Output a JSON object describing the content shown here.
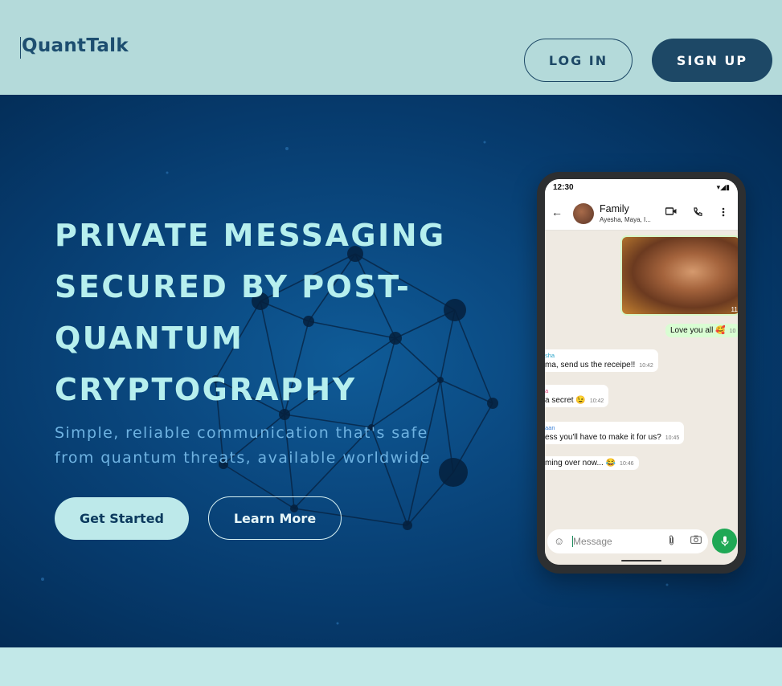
{
  "header": {
    "logo": "QuantTalk",
    "login_label": "LOG IN",
    "signup_label": "SIGN UP"
  },
  "hero": {
    "headline_lines": [
      "PRIVATE MESSAGING",
      "SECURED BY POST-",
      "QUANTUM",
      "CRYPTOGRAPHY"
    ],
    "subhead_lines": [
      "Simple, reliable communication that's safe",
      "from quantum threats, available worldwide"
    ],
    "get_started_label": "Get Started",
    "learn_more_label": "Learn More"
  },
  "phone": {
    "time": "12:30",
    "chat_title": "Family",
    "chat_members": "Ayesha, Maya, I...",
    "photo_time": "11:",
    "messages": [
      {
        "name": "",
        "text": "Love you all 🥰",
        "time": "10",
        "outgoing": true
      },
      {
        "name": "sha",
        "text": "ma, send us the receipe!!",
        "time": "10:42",
        "outgoing": false,
        "name_color": "#2aa4c9"
      },
      {
        "name": "a",
        "text": "a secret 😉",
        "time": "10:42",
        "outgoing": false,
        "name_color": "#e0457b"
      },
      {
        "name": "aan",
        "text": "ess you'll have to make it for us?",
        "time": "10:45",
        "outgoing": false,
        "name_color": "#3a7fd6"
      },
      {
        "name": "",
        "text": "ming over now... 😂",
        "time": "10:46",
        "outgoing": false
      }
    ],
    "composer_placeholder": "Message"
  },
  "colors": {
    "header_bg": "#b4dada",
    "brand_dark": "#1d4866",
    "hero_accent": "#b6efee",
    "hero_sub": "#6fb3e2",
    "footer_bg": "#c2e8e8",
    "mic_green": "#1fa855"
  },
  "icons": {
    "back": "arrow-left-icon",
    "video": "video-call-icon",
    "call": "phone-icon",
    "menu": "more-vertical-icon",
    "emoji": "emoji-icon",
    "attach": "paperclip-icon",
    "camera": "camera-icon",
    "mic": "microphone-icon"
  }
}
